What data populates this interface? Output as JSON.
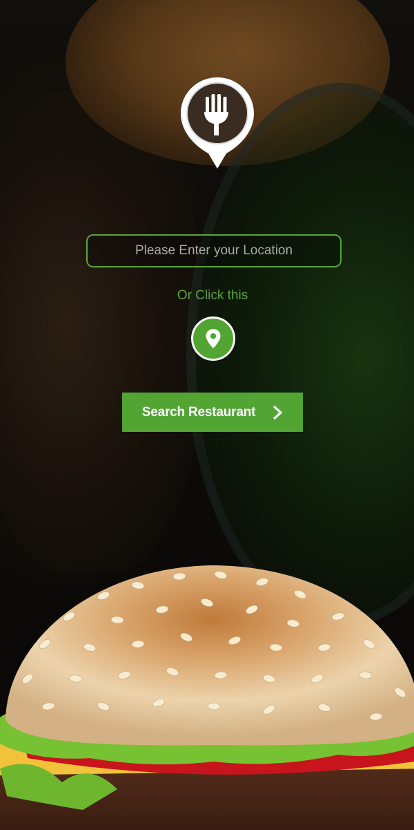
{
  "location_input": {
    "placeholder": "Please Enter your Location",
    "value": ""
  },
  "or_text": "Or Click this",
  "locate_button": {
    "icon": "map-pin-icon"
  },
  "search_button": {
    "label": "Search Restaurant",
    "icon": "chevron-right-icon"
  },
  "logo": {
    "icon": "fork-location-pin-icon"
  },
  "colors": {
    "accent": "#52a532",
    "input_border": "#5aa534",
    "text_light": "#ffffff"
  }
}
